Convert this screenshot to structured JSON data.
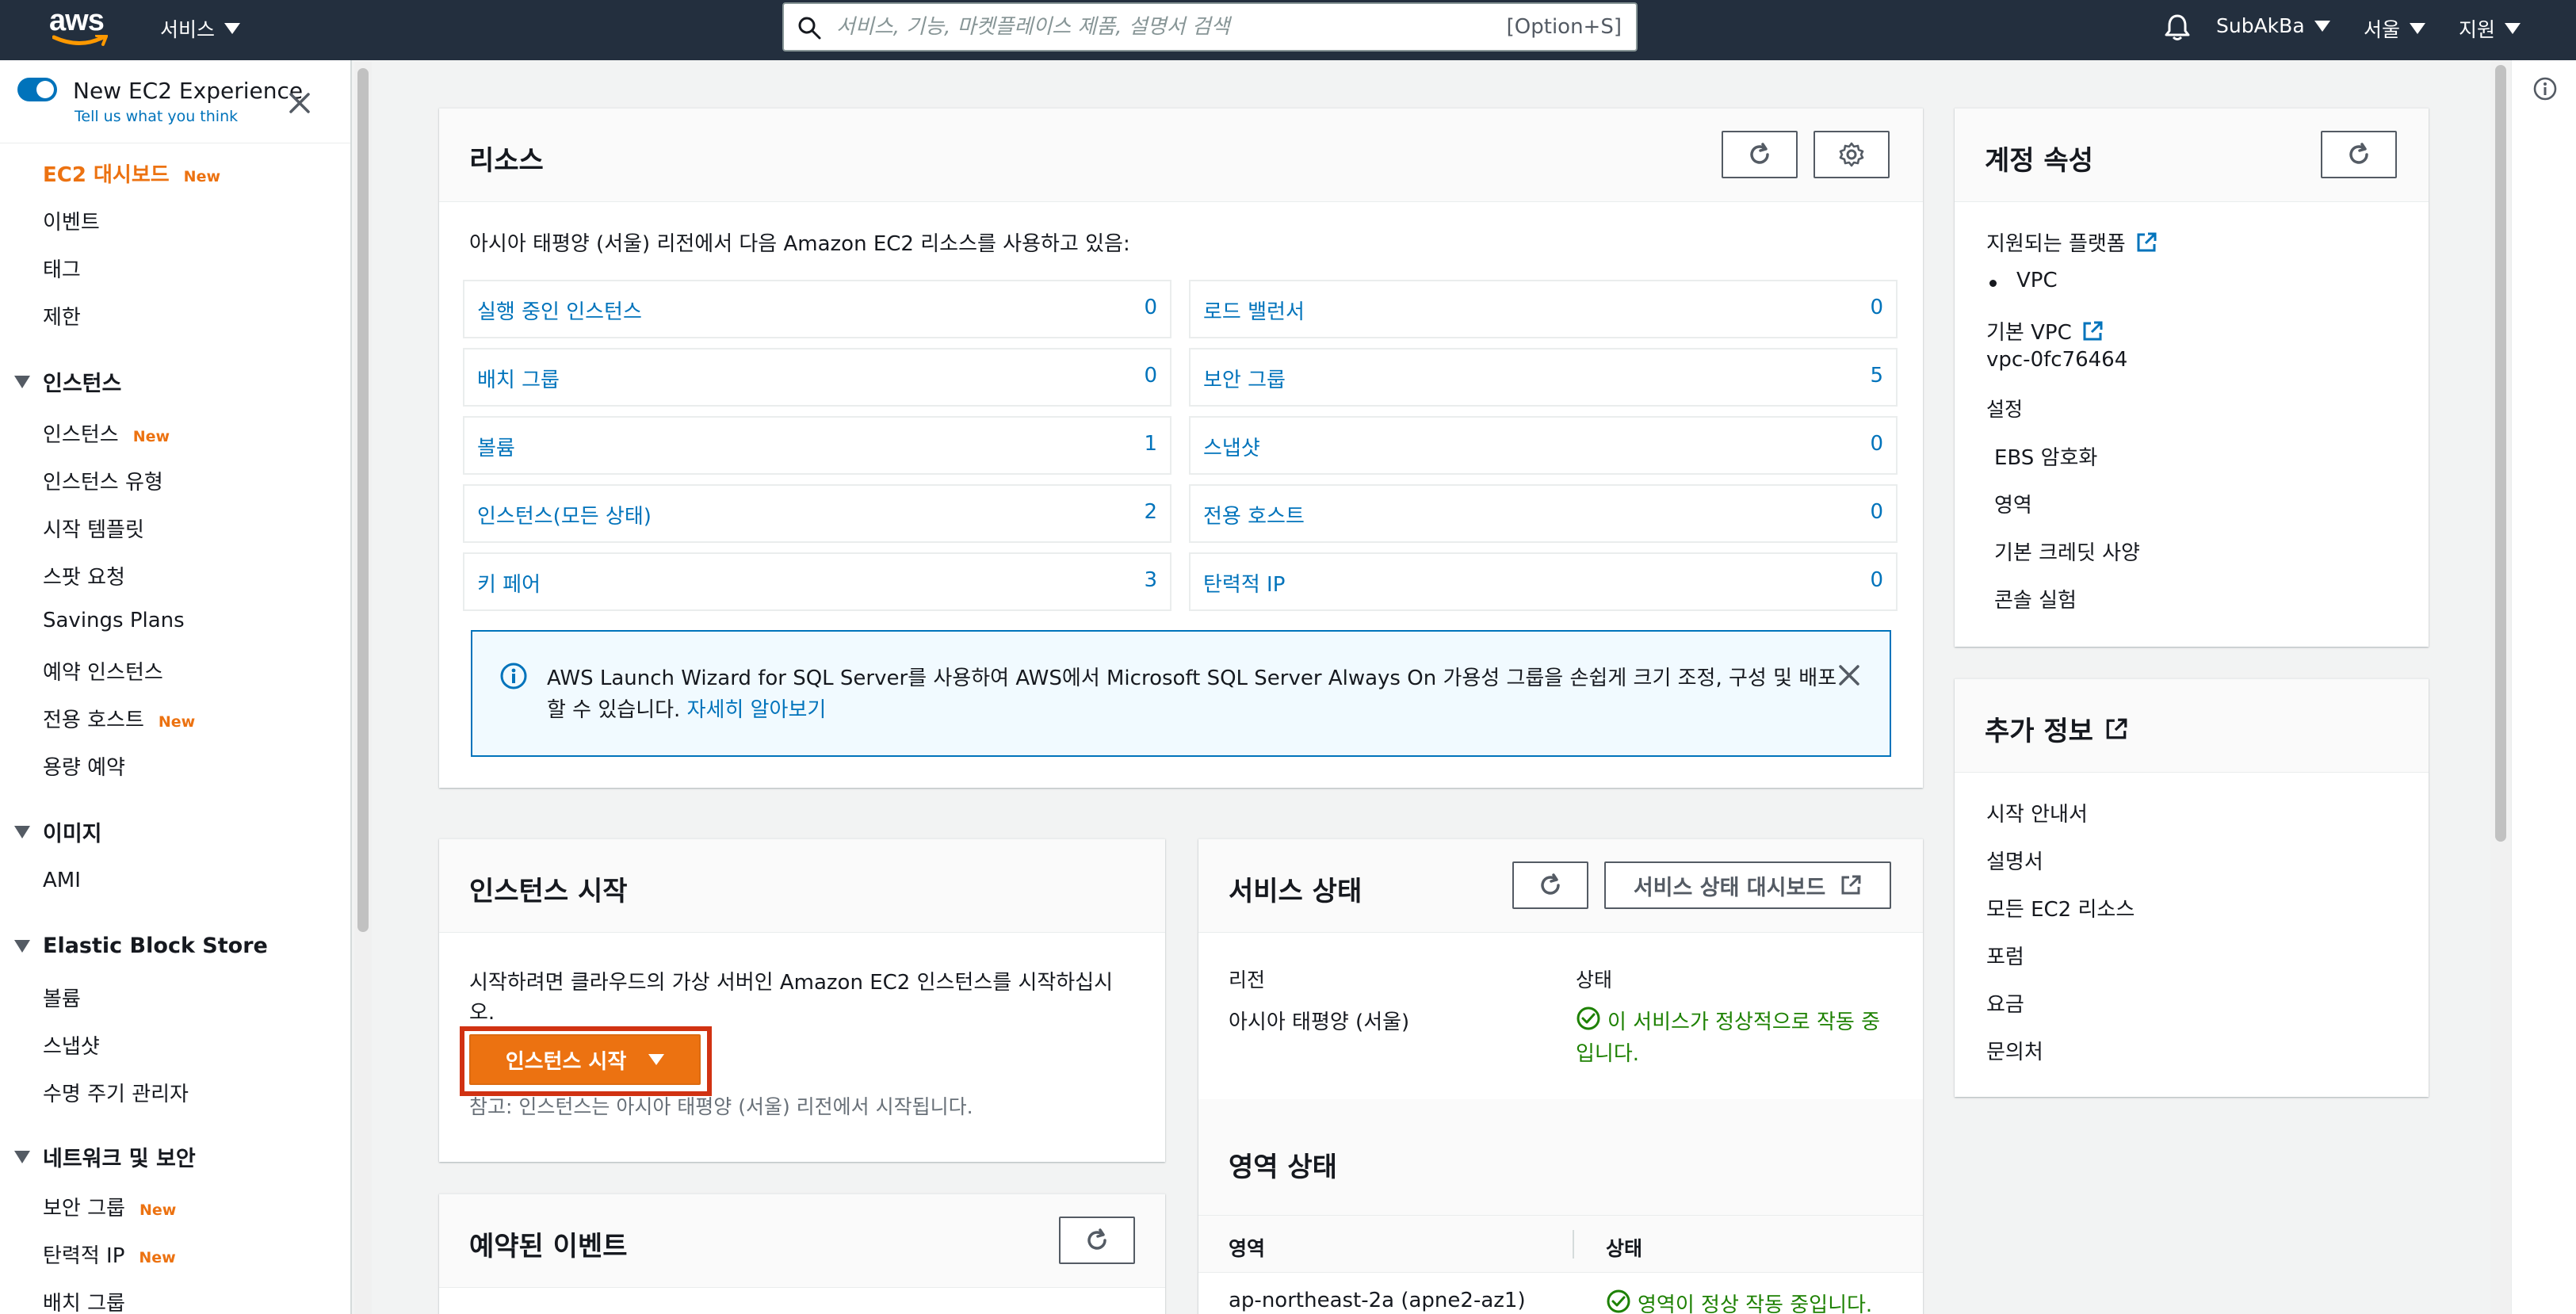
{
  "topnav": {
    "logo": "aws",
    "services_label": "서비스",
    "search_placeholder": "서비스, 기능, 마켓플레이스 제품, 설명서 검색",
    "search_shortcut": "[Option+S]",
    "account_label": "SubAkBa",
    "region_label": "서울",
    "support_label": "지원"
  },
  "sidebar": {
    "experience_title": "New EC2 Experience",
    "experience_sub": "Tell us what you think",
    "new_badge": "New",
    "top_items": [
      "EC2 대시보드",
      "이벤트",
      "태그",
      "제한"
    ],
    "sections": {
      "instances": {
        "title": "인스턴스",
        "items": [
          "인스턴스",
          "인스턴스 유형",
          "시작 템플릿",
          "스팟 요청",
          "Savings Plans",
          "예약 인스턴스",
          "전용 호스트",
          "용량 예약"
        ]
      },
      "images": {
        "title": "이미지",
        "items": [
          "AMI"
        ]
      },
      "ebs": {
        "title": "Elastic Block Store",
        "items": [
          "볼륨",
          "스냅샷",
          "수명 주기 관리자"
        ]
      },
      "network": {
        "title": "네트워크 및 보안",
        "items": [
          "보안 그룹",
          "탄력적 IP",
          "배치 그룹"
        ]
      }
    }
  },
  "resources": {
    "title": "리소스",
    "intro": "아시아 태평양 (서울) 리전에서 다음 Amazon EC2 리소스를 사용하고 있음:",
    "left": [
      {
        "label": "실행 중인 인스턴스",
        "value": "0"
      },
      {
        "label": "배치 그룹",
        "value": "0"
      },
      {
        "label": "볼륨",
        "value": "1"
      },
      {
        "label": "인스턴스(모든 상태)",
        "value": "2"
      },
      {
        "label": "키 페어",
        "value": "3"
      }
    ],
    "right": [
      {
        "label": "로드 밸런서",
        "value": "0"
      },
      {
        "label": "보안 그룹",
        "value": "5"
      },
      {
        "label": "스냅샷",
        "value": "0"
      },
      {
        "label": "전용 호스트",
        "value": "0"
      },
      {
        "label": "탄력적 IP",
        "value": "0"
      }
    ],
    "info_line1": "AWS Launch Wizard for SQL Server를 사용하여 AWS에서 Microsoft SQL Server Always On 가용성 그룹을 손쉽게 크기 조정, 구성 및 배포",
    "info_line2": "할 수 있습니다.",
    "info_link": "자세히 알아보기"
  },
  "launch": {
    "title": "인스턴스 시작",
    "desc_line1": "시작하려면 클라우드의 가상 서버인 Amazon EC2 인스턴스를 시작하십시",
    "desc_line2": "오.",
    "button": "인스턴스 시작",
    "note": "참고: 인스턴스는 아시아 태평양 (서울) 리전에서 시작됩니다."
  },
  "events": {
    "title": "예약된 이벤트"
  },
  "service_health": {
    "title": "서비스 상태",
    "dashboard_button": "서비스 상태 대시보드",
    "region_label": "리전",
    "region_value": "아시아 태평양 (서울)",
    "status_label": "상태",
    "status_line1": "이 서비스가 정상적으로 작동 중",
    "status_line2": "입니다."
  },
  "zone_status": {
    "title": "영역 상태",
    "col_zone": "영역",
    "col_status": "상태",
    "rows": [
      {
        "zone": "ap-northeast-2a (apne2-az1)",
        "status": "영역이 정상 작동 중입니다."
      }
    ]
  },
  "account": {
    "title": "계정 속성",
    "supported_platforms": "지원되는 플랫폼",
    "platform_item": "VPC",
    "default_vpc": "기본 VPC",
    "vpc_id": "vpc-0fc76464",
    "settings_label": "설정",
    "settings_links": [
      "EBS 암호화",
      "영역",
      "기본 크레딧 사양",
      "콘솔 실험"
    ]
  },
  "more_info": {
    "title": "추가 정보",
    "links": [
      "시작 안내서",
      "설명서",
      "모든 EC2 리소스",
      "포럼",
      "요금",
      "문의처"
    ]
  },
  "colors": {
    "nav_bg": "#232f3e",
    "link": "#0073bb",
    "accent_orange": "#ec7211",
    "ok_green": "#1d8102",
    "highlight_red": "#d13212"
  }
}
